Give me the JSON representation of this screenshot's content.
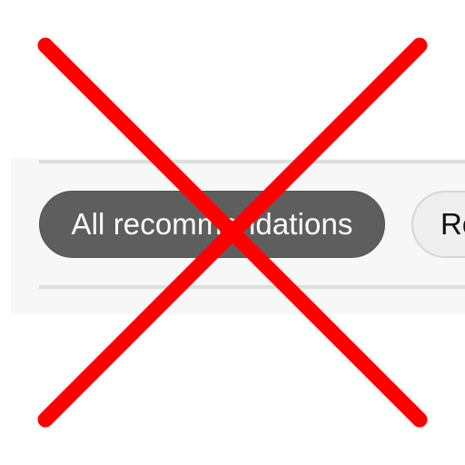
{
  "chips": {
    "selected_label": "All recommendations",
    "next_label": "Ro"
  },
  "overlay": {
    "icon": "cross-out-x",
    "color": "#ff0000"
  },
  "colors": {
    "chip_selected_bg": "#5e5e5e",
    "chip_unselected_bg": "#efefef",
    "bar_bg": "#f7f7f7"
  }
}
